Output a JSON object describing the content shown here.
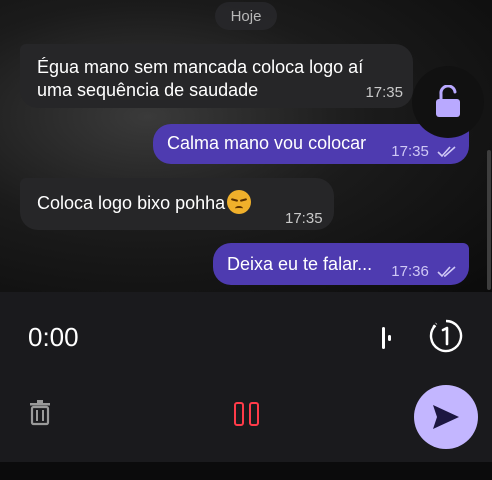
{
  "chat": {
    "date_chip": "Hoje",
    "messages": [
      {
        "direction": "incoming",
        "text": "Égua mano sem mancada coloca logo aí uma sequência de saudade",
        "time": "17:35"
      },
      {
        "direction": "outgoing",
        "text": "Calma mano vou colocar",
        "time": "17:35",
        "status": "read"
      },
      {
        "direction": "incoming",
        "text": "Coloca logo bixo pohha",
        "emoji": "unamused-face",
        "time": "17:35"
      },
      {
        "direction": "outgoing",
        "text": "Deixa eu te falar...",
        "time": "17:36",
        "status": "read"
      }
    ]
  },
  "recorder": {
    "timer": "0:00",
    "icons": [
      "waveform-icon",
      "view-once-icon",
      "trash-icon",
      "pause-icon",
      "send-icon",
      "unlock-icon"
    ]
  },
  "colors": {
    "outgoing_bubble": "#4e3bb0",
    "incoming_bubble": "#262628",
    "accent": "#c3b6ff",
    "pause_red": "#ff3b49"
  }
}
